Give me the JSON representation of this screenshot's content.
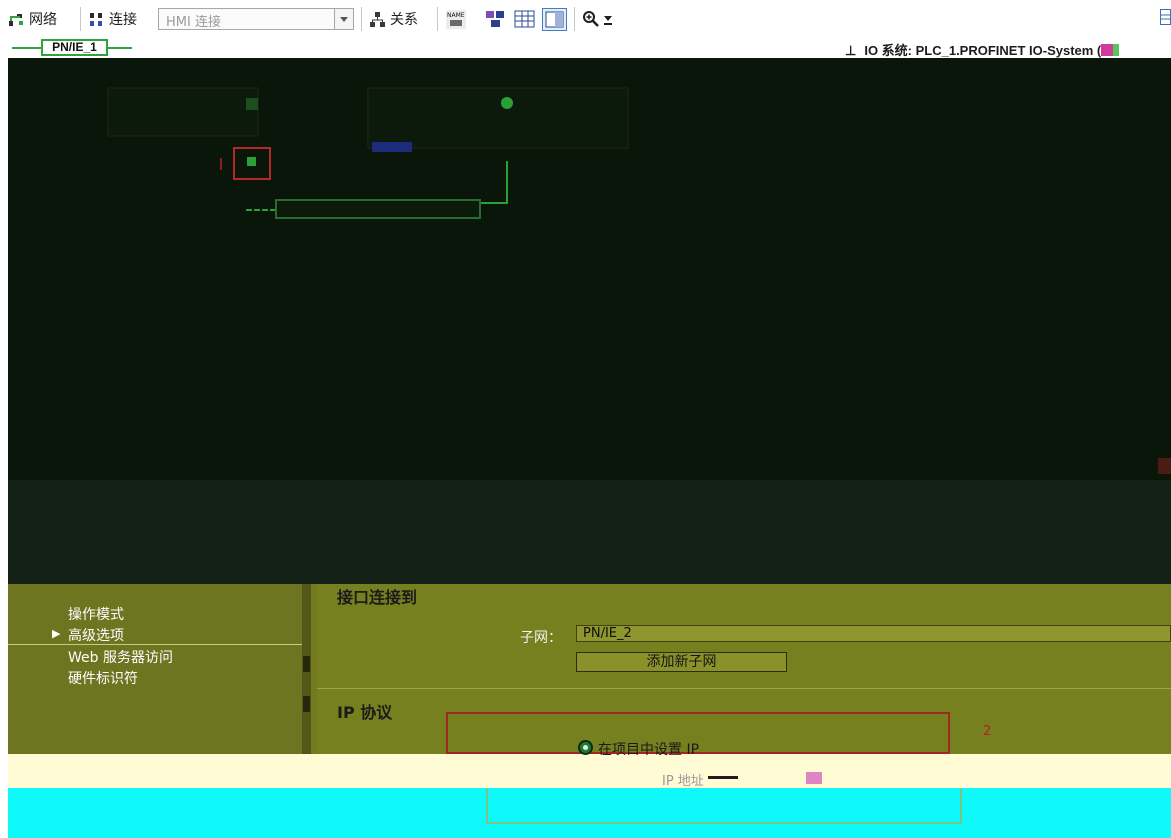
{
  "toolbar": {
    "network_label": "网络",
    "connect_label": "连接",
    "hmi_select_value": "HMI 连接",
    "relation_label": "关系"
  },
  "network_strip": {
    "subnet_label": "PN/IE_1",
    "io_system_title": "IO 系统: PLC_1.PROFINET IO-System ("
  },
  "properties": {
    "nav_items": [
      "操作模式",
      "高级选项",
      "Web 服务器访问",
      "硬件标识符"
    ],
    "interface_section_title": "接口连接到",
    "subnet_field_label": "子网：",
    "subnet_value": "PN/IE_2",
    "add_subnet_button": "添加新子网",
    "ip_section_title": "IP 协议",
    "ip_option_label": "在项目中设置 IP",
    "ip_address_label": "IP 地址",
    "marker_number": "2"
  },
  "colors": {
    "canvas_bg": "#0a1609",
    "properties_bg": "#77801f",
    "profinet_green": "#2ea43a",
    "highlight_red": "#a12820",
    "cream_overlay": "#fffbd4",
    "cyan_overlay": "#0ff9fb"
  }
}
